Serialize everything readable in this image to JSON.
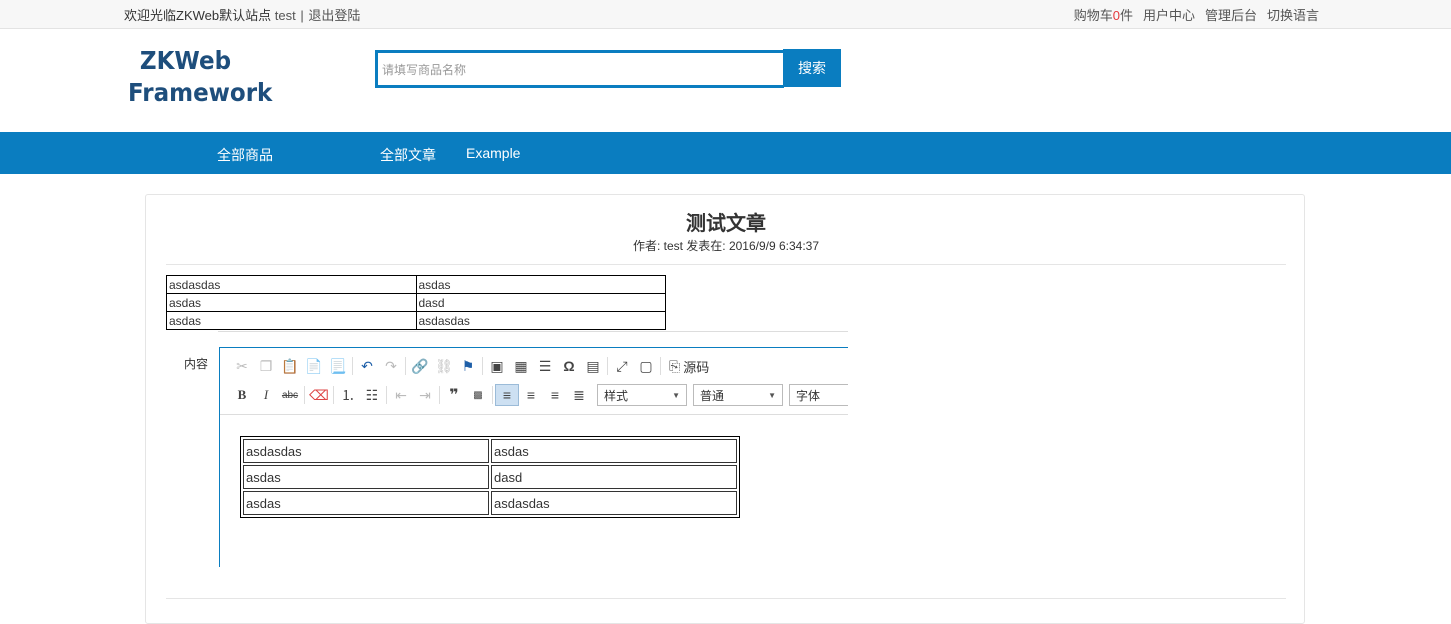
{
  "topbar": {
    "welcome": "欢迎光临ZKWeb默认站点",
    "username": "test",
    "separator": "|",
    "logout": "退出登陆",
    "cart_prefix": "购物车",
    "cart_count": "0",
    "cart_suffix": "件",
    "user_center": "用户中心",
    "admin": "管理后台",
    "switch_language": "切换语言"
  },
  "header": {
    "logo_line1": "ZKWeb",
    "logo_line2": "Framework",
    "search_placeholder": "请填写商品名称",
    "search_button": "搜索"
  },
  "nav": {
    "items": [
      {
        "label": "全部商品"
      },
      {
        "label": "全部文章"
      },
      {
        "label": "Example"
      }
    ]
  },
  "article": {
    "title": "测试文章",
    "meta": "作者: test 发表在: 2016/9/9 6:34:37",
    "table": [
      [
        "asdasdas",
        "asdas"
      ],
      [
        "asdas",
        "dasd"
      ],
      [
        "asdas",
        "asdasdas"
      ]
    ]
  },
  "form": {
    "content_label": "内容"
  },
  "editor": {
    "source_label": "源码",
    "style_select": "样式",
    "format_select": "普通",
    "font_select": "字体",
    "table": [
      [
        "asdasdas",
        "asdas"
      ],
      [
        "asdas",
        "dasd"
      ],
      [
        "asdas",
        "asdasdas"
      ]
    ]
  },
  "colors": {
    "brand": "#0a7dc0",
    "logo": "#1e4e7c",
    "cart_count": "#e4393c"
  }
}
